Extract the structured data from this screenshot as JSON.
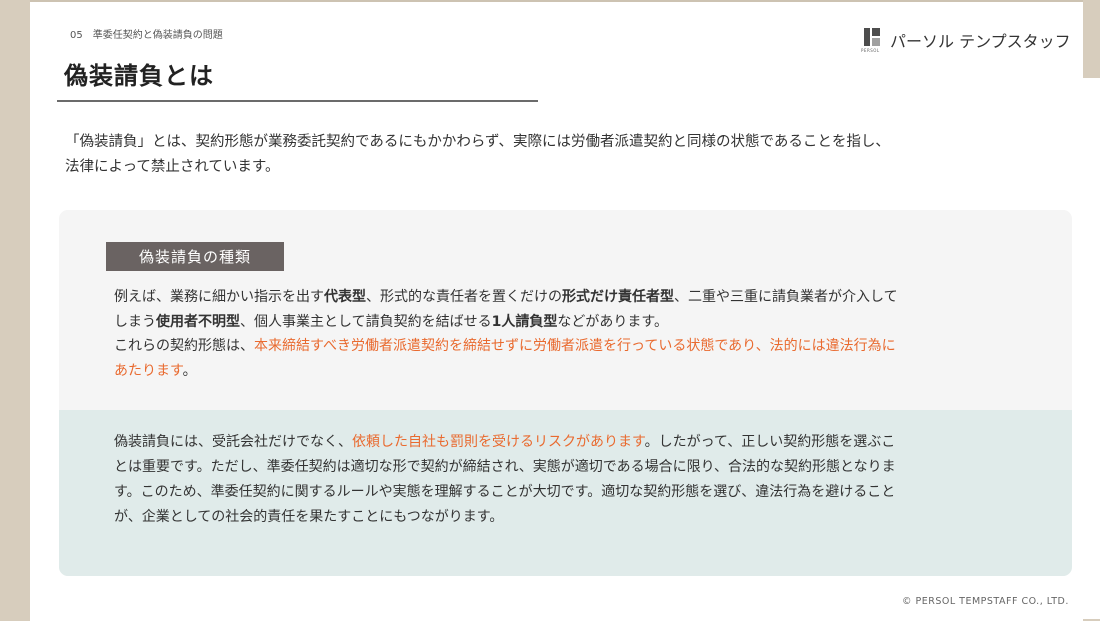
{
  "header": {
    "section_number": "05",
    "section_title": "準委任契約と偽装請負の問題",
    "page_title": "偽装請負とは",
    "logo_text": "パーソル テンプスタッフ",
    "logo_sub": "PERSOL"
  },
  "intro": {
    "line1": "「偽装請負」とは、契約形態が業務委託契約であるにもかかわらず、実際には労働者派遣契約と同様の状態であることを指し、",
    "line2": "法律によって禁止されています。"
  },
  "types_box": {
    "label": "偽装請負の種類",
    "p1_a": "例えば、業務に細かい指示を出す",
    "p1_b": "代表型",
    "p1_c": "、形式的な責任者を置くだけの",
    "p1_d": "形式だけ責任者型",
    "p1_e": "、二重や三重に請負業者が介入して",
    "p1_f": "しまう",
    "p1_g": "使用者不明型",
    "p1_h": "、個人事業主として請負契約を結ばせる",
    "p1_i": "1人請負型",
    "p1_j": "などがあります。",
    "p2_a": "これらの契約形態は、",
    "p2_b": "本来締結すべき労働者派遣契約を締結せずに労働者派遣を行っている状態であり、法的には違法行為に",
    "p2_c": "あたります",
    "p2_d": "。"
  },
  "risk_box": {
    "a": "偽装請負には、受託会社だけでなく、",
    "b": "依頼した自社も罰則を受けるリスクがあります",
    "c": "。したがって、正しい契約形態を選ぶこ",
    "d": "とは重要です。ただし、準委任契約は適切な形で契約が締結され、実態が適切である場合に限り、合法的な契約形態となりま",
    "e": "す。このため、準委任契約に関するルールや実態を理解することが大切です。適切な契約形態を選び、違法行為を避けること",
    "f": "が、企業としての社会的責任を果たすことにもつながります。"
  },
  "footer": {
    "copyright": "© PERSOL TEMPSTAFF CO., LTD."
  },
  "colors": {
    "accent": "#e96a2f",
    "label_bg": "#6a6362",
    "box_gray": "#f5f5f5",
    "box_teal": "#e0ebea"
  }
}
